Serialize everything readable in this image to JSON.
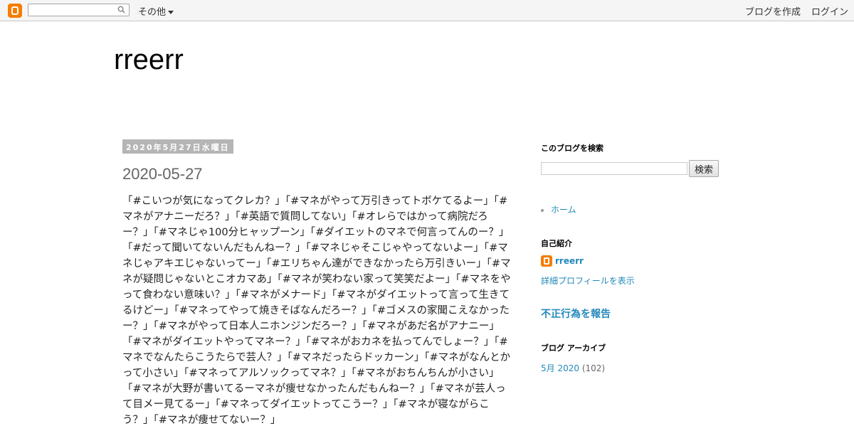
{
  "navbar": {
    "more_label": "その他",
    "create_blog": "ブログを作成",
    "login": "ログイン"
  },
  "header": {
    "title": "rreerr"
  },
  "post": {
    "date_header": "2020年5月27日水曜日",
    "title": "2020-05-27",
    "body": "「#こいつが気になってクレカ？」「#マネがやって万引きってトボケてるよー」「#マネがアナニーだろ？」「#英語で質問してない」「#オレらではかって病院だろー？」「#マネじゃ100分ヒャップーン」「#ダイエットのマネで何言ってんのー？」「#だって聞いてないんだもんねー？」「#マネじゃそこじゃやってないよー」「#マネじゃアキエじゃないってー」「#エリちゃん達ができなかったら万引きいー」「#マネが疑問じゃないとこオカマあ」「#マネが笑わない家って笑笑だよー」「#マネをやって食わない意味い？」「#マネがメナード」「#マネがダイエットって言って生きてるけどー」「#マネってやって焼きそばなんだろー？」「#ゴメスの家聞こえなかったー？」「#マネがやって日本人ニホンジンだろー？」「#マネがあだ名がアナニー」「#マネがダイエットやってマネー？」「#マネがおカネを払ってんでしょー？」「#マネでなんたらこうたらで芸人？」「#マネだったらドッカーン」「#マネがなんとかって小さい」「#マネってアルソックってマネ？」「#マネがおちんちんが小さい」「#マネが大野が書いてるーマネが痩せなかったんだもんねー？」「#マネが芸人って目メー見てるー」「#マネってダイエットってこうー？」「#マネが寝ながらこう？」「#マネが痩せてないー？」"
  },
  "sidebar": {
    "search_heading": "このブログを検索",
    "search_button": "検索",
    "home_link": "ホーム",
    "profile_heading": "自己紹介",
    "profile_name": "rreerr",
    "profile_link": "詳細プロフィールを表示",
    "report_link": "不正行為を報告",
    "archive_heading": "ブログ アーカイブ",
    "archive_month": "5月 2020",
    "archive_count": "(102)"
  },
  "colors": {
    "blogger_orange": "#f57d00",
    "link_blue": "#2288bb",
    "date_header_bg": "#b5b5b5"
  }
}
